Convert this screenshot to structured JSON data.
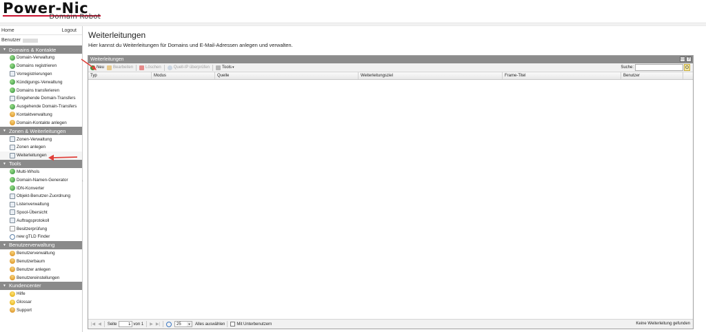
{
  "app": {
    "logo_main": "Power-Nic",
    "logo_sub": "Domain Robot"
  },
  "sidebar": {
    "home": "Home",
    "logout": "Logout",
    "user_label": "Benutzer",
    "groups": [
      {
        "title": "Domains & Kontakte",
        "items": [
          {
            "label": "Domain-Verwaltung",
            "icon": "globe-icon"
          },
          {
            "label": "Domains registrieren",
            "icon": "globe-icon"
          },
          {
            "label": "Vorregistrierungen",
            "icon": "doc-icon"
          },
          {
            "label": "Kündigungs-Verwaltung",
            "icon": "globe-icon"
          },
          {
            "label": "Domains transferieren",
            "icon": "globe-icon"
          },
          {
            "label": "Eingehende Domain-Transfers",
            "icon": "doc-icon"
          },
          {
            "label": "Ausgehende Domain-Transfers",
            "icon": "globe-icon"
          },
          {
            "label": "Kontaktverwaltung",
            "icon": "user-icon"
          },
          {
            "label": "Domain-Kontakte anlegen",
            "icon": "user-icon"
          }
        ]
      },
      {
        "title": "Zonen & Weiterleitungen",
        "items": [
          {
            "label": "Zonen-Verwaltung",
            "icon": "doc-icon"
          },
          {
            "label": "Zonen anlegen",
            "icon": "doc-icon"
          },
          {
            "label": "Weiterleitungen",
            "icon": "doc-icon",
            "active": true
          }
        ]
      },
      {
        "title": "Tools",
        "items": [
          {
            "label": "Multi-WhoIs",
            "icon": "globe-icon"
          },
          {
            "label": "Domain-Namen-Generator",
            "icon": "globe-icon"
          },
          {
            "label": "IDN-Konverter",
            "icon": "globe-icon"
          },
          {
            "label": "Objekt-Benutzer-Zuordnung",
            "icon": "doc-icon"
          },
          {
            "label": "Listenverwaltung",
            "icon": "doc-icon"
          },
          {
            "label": "Spool-Übersicht",
            "icon": "doc-icon"
          },
          {
            "label": "Auftragsprotokoll",
            "icon": "doc-icon"
          },
          {
            "label": "Besitzerprüfung",
            "icon": "key-icon"
          },
          {
            "label": "new gTLD Finder",
            "icon": "magnifier-icon"
          }
        ]
      },
      {
        "title": "Benutzerverwaltung",
        "items": [
          {
            "label": "Benutzerverwaltung",
            "icon": "user-icon"
          },
          {
            "label": "Benutzerbaum",
            "icon": "user-icon"
          },
          {
            "label": "Benutzer anlegen",
            "icon": "user-icon"
          },
          {
            "label": "Benutzereinstellungen",
            "icon": "user-icon"
          }
        ]
      },
      {
        "title": "Kundencenter",
        "items": [
          {
            "label": "Hilfe",
            "icon": "bulb-icon"
          },
          {
            "label": "Glossar",
            "icon": "bulb-icon"
          },
          {
            "label": "Support",
            "icon": "user-icon"
          }
        ]
      }
    ]
  },
  "main": {
    "title": "Weiterleitungen",
    "subtitle": "Hier kannst du Weiterleitungen für Domains und E-Mail-Adressen anlegen und verwalten.",
    "panel_title": "Weiterleitungen",
    "toolbar": {
      "new": "Neu",
      "edit": "Bearbeiten",
      "delete": "Löschen",
      "check_ip": "Quell-IP überprüfen",
      "tools": "Tools",
      "search_label": "Suche:",
      "search_value": ""
    },
    "columns": [
      "Typ",
      "Modus",
      "Quelle",
      "Weiterleitungsziel",
      "Frame-Titel",
      "Benutzer"
    ],
    "pager": {
      "page_label": "Seite",
      "page_value": "1",
      "of_label": "von 1",
      "page_size": "25",
      "select_all": "Alles auswählen",
      "with_subusers": "Mit Unterbenutzern",
      "status": "Keine Weiterleitung gefunden"
    }
  },
  "colors": {
    "accent_red": "#e0403a",
    "group_header": "#8a8a8a",
    "panel_header": "#8c8c8c"
  }
}
